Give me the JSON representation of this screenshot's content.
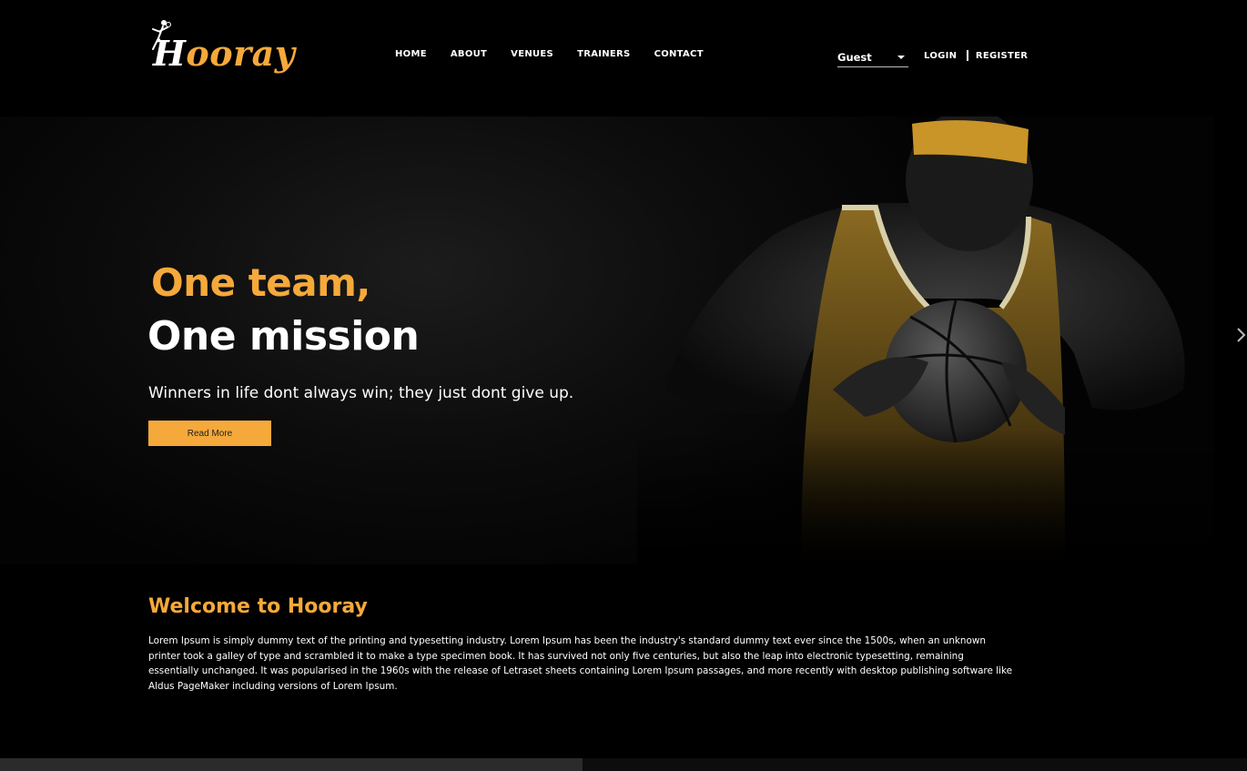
{
  "brand": {
    "name_first_letter": "H",
    "name_rest": "ooray",
    "accent_color": "#f5a93b"
  },
  "nav": {
    "items": [
      {
        "label": "HOME"
      },
      {
        "label": "ABOUT"
      },
      {
        "label": "VENUES"
      },
      {
        "label": "TRAINERS"
      },
      {
        "label": "CONTACT"
      }
    ]
  },
  "user_select": {
    "value": "Guest"
  },
  "auth": {
    "login": "LOGIN",
    "register": "REGISTER"
  },
  "hero": {
    "title_line1": "One team,",
    "title_line2": "One mission",
    "subtitle": "Winners in life dont always win; they just dont give up.",
    "button_label": "Read More"
  },
  "welcome": {
    "title": "Welcome to Hooray",
    "body": "Lorem Ipsum is simply dummy text of the printing and typesetting industry. Lorem Ipsum has been the industry's standard dummy text ever since the 1500s, when an unknown printer took a galley of type and scrambled it to make a type specimen book. It has survived not only five centuries, but also the leap into electronic typesetting, remaining essentially unchanged. It was popularised in the 1960s with the release of Letraset sheets containing Lorem Ipsum passages, and more recently with desktop publishing software like Aldus PageMaker including versions of Lorem Ipsum."
  },
  "icons": {
    "logo": "basketball-player-icon",
    "dropdown": "caret-down-icon",
    "carousel_next": "chevron-right-icon"
  }
}
